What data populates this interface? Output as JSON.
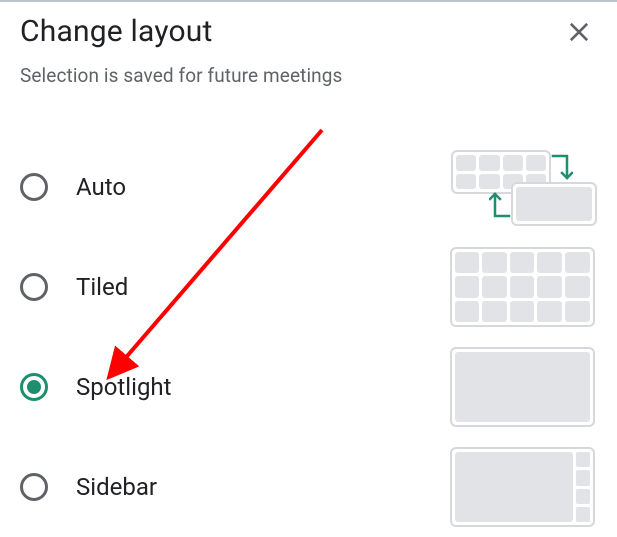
{
  "dialog": {
    "title": "Change layout",
    "subtitle": "Selection is saved for future meetings",
    "options": [
      {
        "label": "Auto",
        "selected": false
      },
      {
        "label": "Tiled",
        "selected": false
      },
      {
        "label": "Spotlight",
        "selected": true
      },
      {
        "label": "Sidebar",
        "selected": false
      }
    ]
  }
}
